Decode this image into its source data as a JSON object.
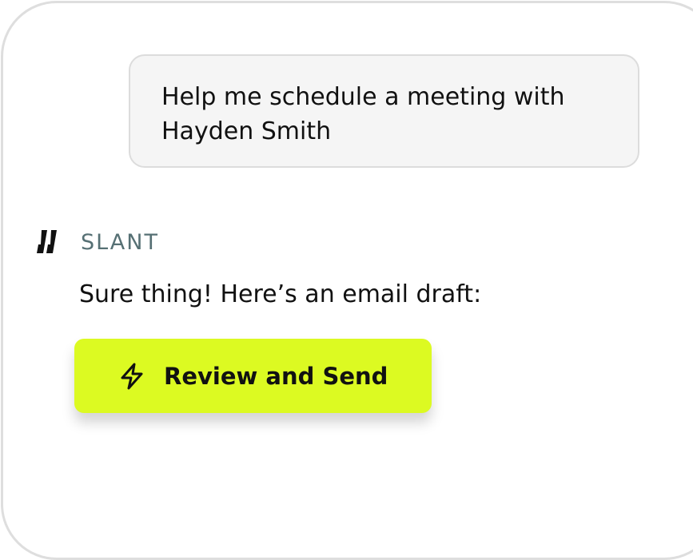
{
  "user_message": {
    "text_line_1": "Help me schedule a meeting with",
    "text_line_2": "Hayden Smith"
  },
  "assistant": {
    "logo_icon": "slant-logo-icon",
    "name": "SLANT",
    "message": "Sure thing! Here’s an email draft:"
  },
  "action": {
    "icon": "lightning-bolt-icon",
    "label": "Review and Send"
  },
  "colors": {
    "accent": "#dcfa22",
    "brand_text": "#567074",
    "bubble_background": "#f5f5f5",
    "frame_border": "#dedede"
  }
}
